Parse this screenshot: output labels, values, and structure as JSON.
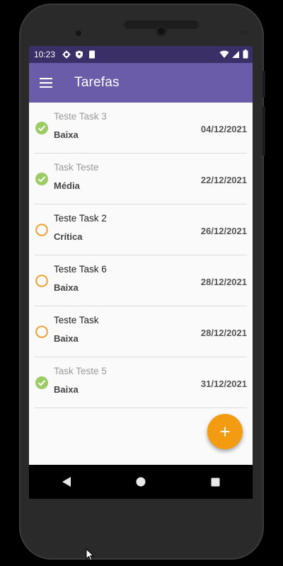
{
  "status_bar": {
    "time": "10:23"
  },
  "app_bar": {
    "title": "Tarefas"
  },
  "tasks": [
    {
      "name": "Teste Task 3",
      "priority": "Baixa",
      "date": "04/12/2021",
      "done": true
    },
    {
      "name": "Task Teste",
      "priority": "Média",
      "date": "22/12/2021",
      "done": true
    },
    {
      "name": "Teste Task 2",
      "priority": "Crítica",
      "date": "26/12/2021",
      "done": false
    },
    {
      "name": "Teste Task 6",
      "priority": "Baixa",
      "date": "28/12/2021",
      "done": false
    },
    {
      "name": "Teste Task",
      "priority": "Baixa",
      "date": "28/12/2021",
      "done": false
    },
    {
      "name": "Task Teste 5",
      "priority": "Baixa",
      "date": "31/12/2021",
      "done": true
    }
  ],
  "fab": {
    "label": "+",
    "icon": "add-icon"
  },
  "colors": {
    "app_bar": "#6a5ca8",
    "status_bar": "#3a2f66",
    "done_check": "#9ccc65",
    "pending_circle": "#f0a030",
    "fab": "#f39c12"
  }
}
